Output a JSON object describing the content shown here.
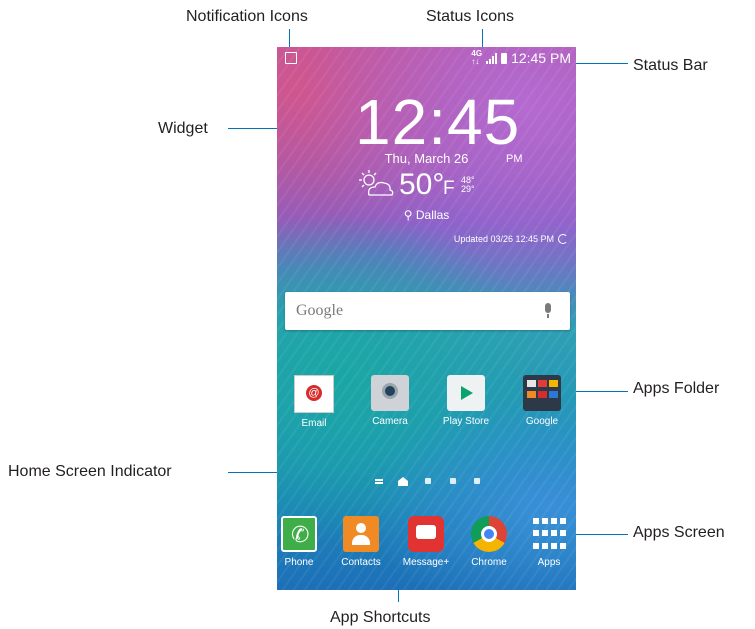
{
  "callouts": {
    "notification_icons": "Notification Icons",
    "status_icons": "Status Icons",
    "status_bar": "Status Bar",
    "widget": "Widget",
    "apps_folder": "Apps Folder",
    "home_screen_indicator": "Home Screen Indicator",
    "apps_screen": "Apps Screen",
    "app_shortcuts": "App Shortcuts"
  },
  "statusbar": {
    "network": "4G LTE",
    "time": "12:45 PM"
  },
  "widget": {
    "time": "12:45",
    "ampm": "PM",
    "date": "Thu, March 26",
    "temperature": "50°",
    "unit": "F",
    "high": "48°",
    "low": "29°",
    "location": "Dallas",
    "updated": "Updated 03/26 12:45 PM"
  },
  "search": {
    "placeholder": "Google"
  },
  "apps": [
    "Email",
    "Camera",
    "Play Store",
    "Google"
  ],
  "dock": [
    "Phone",
    "Contacts",
    "Message+",
    "Chrome",
    "Apps"
  ],
  "home_pages": {
    "count": 4,
    "current": 1
  },
  "colors": {
    "callout_line": "#0076b6"
  }
}
